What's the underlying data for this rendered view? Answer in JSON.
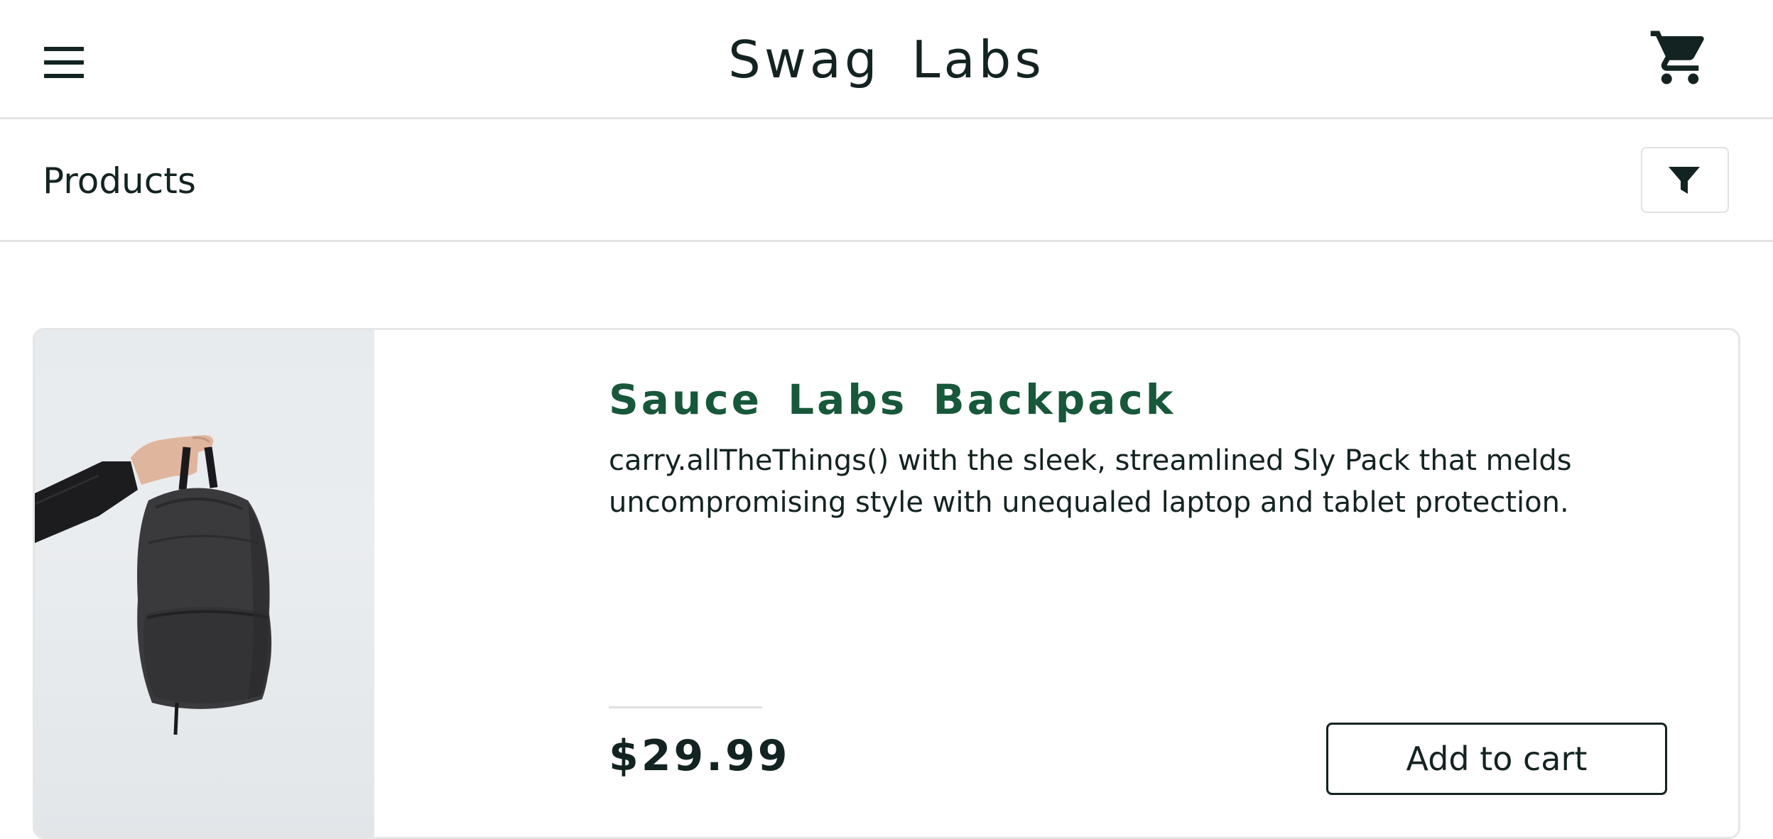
{
  "header": {
    "app_title": "Swag Labs",
    "menu_icon": "hamburger-menu-icon",
    "cart_icon": "shopping-cart-icon"
  },
  "subheader": {
    "page_title": "Products",
    "filter_icon": "filter-funnel-icon"
  },
  "inventory": {
    "items": [
      {
        "name": "Sauce Labs Backpack",
        "description": "carry.allTheThings() with the sleek, streamlined Sly Pack that melds uncompromising style with unequaled laptop and tablet protection.",
        "price": "$29.99",
        "button_label": "Add to cart"
      }
    ]
  },
  "colors": {
    "product_name": "#18583a",
    "text": "#132322",
    "border": "#e4e4e4"
  }
}
